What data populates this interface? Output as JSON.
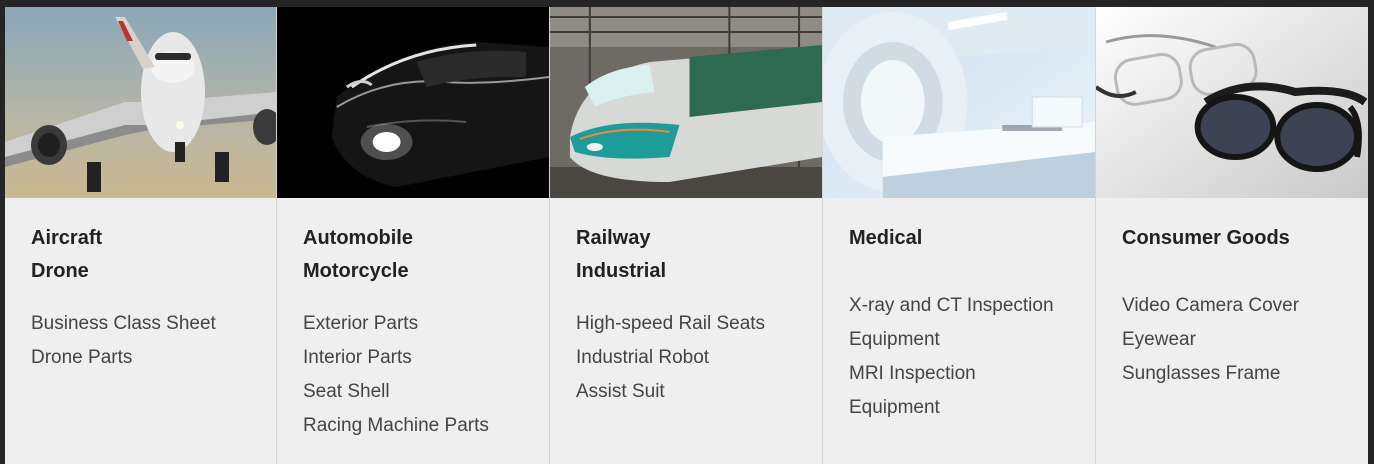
{
  "categories": [
    {
      "titles": [
        "Aircraft",
        "Drone"
      ],
      "items": [
        "Business Class Sheet",
        "Drone Parts"
      ],
      "image": "airplane-photo"
    },
    {
      "titles": [
        "Automobile",
        "Motorcycle"
      ],
      "items": [
        "Exterior Parts",
        "Interior Parts",
        "Seat Shell",
        "Racing Machine Parts"
      ],
      "image": "sports-car-photo"
    },
    {
      "titles": [
        "Railway",
        "Industrial"
      ],
      "items": [
        "High-speed Rail Seats",
        "Industrial Robot",
        "Assist Suit"
      ],
      "image": "bullet-train-photo"
    },
    {
      "titles": [
        "Medical"
      ],
      "items": [
        "X-ray and CT Inspection",
        "Equipment",
        "MRI Inspection",
        "Equipment"
      ],
      "image": "ct-scanner-photo"
    },
    {
      "titles": [
        "Consumer Goods"
      ],
      "items": [
        "Video Camera Cover",
        "Eyewear",
        "Sunglasses Frame"
      ],
      "image": "eyewear-photo"
    }
  ],
  "colors": {
    "page_background": "#252525",
    "card_background": "#efefef",
    "title_text": "#222222",
    "item_text": "#444444"
  }
}
